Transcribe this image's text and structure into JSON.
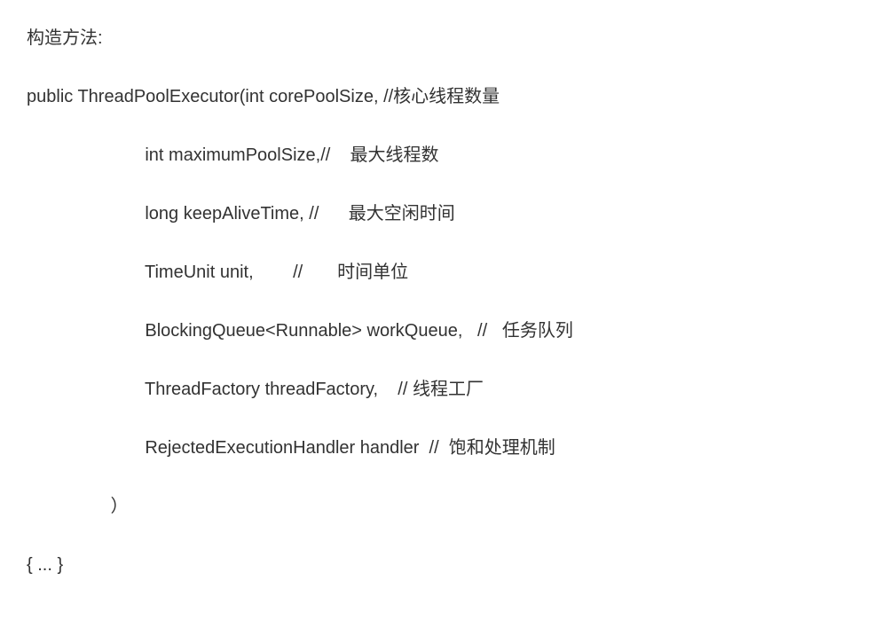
{
  "header": "构造方法:",
  "signature_open": "public ThreadPoolExecutor(int corePoolSize, //核心线程数量",
  "params": [
    "                        int maximumPoolSize,//    最大线程数",
    "                        long keepAliveTime, //      最大空闲时间",
    "                        TimeUnit unit,        //       时间单位",
    "                        BlockingQueue<Runnable> workQueue,   //   任务队列",
    "                        ThreadFactory threadFactory,    // 线程工厂",
    "                        RejectedExecutionHandler handler  //  饱和处理机制"
  ],
  "close_paren": "                 ）",
  "body": "{ ... }"
}
